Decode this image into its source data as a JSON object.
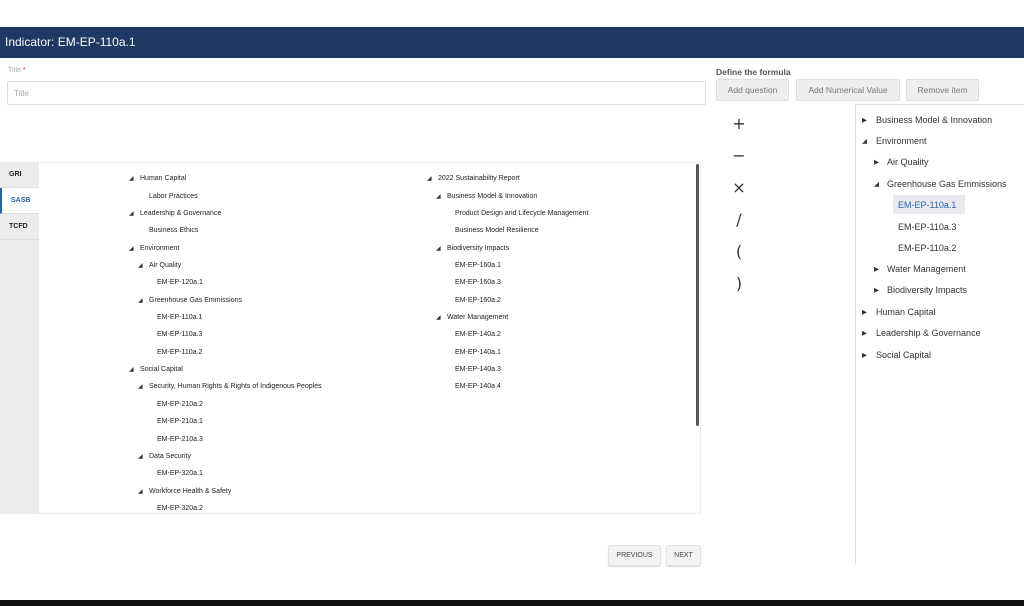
{
  "header": {
    "title": "Indicator: EM-EP-110a.1"
  },
  "title_field": {
    "label": "Title",
    "required_mark": "*",
    "placeholder": "Title",
    "value": ""
  },
  "formula": {
    "title": "Define the formula",
    "buttons": {
      "add_question": "Add question",
      "add_numerical": "Add Numerical Value",
      "remove_item": "Remove item"
    },
    "operators": [
      "+",
      "−",
      "×",
      "/",
      "(",
      ")"
    ]
  },
  "tabs": [
    "GRI",
    "SASB",
    "TCFD"
  ],
  "active_tab": "SASB",
  "left_tree": [
    "Human Capital",
    "Labor Practices",
    "Leadership & Governance",
    "Business Ethics",
    "Environment",
    "Air Quality",
    "EM-EP-120a.1",
    "Greenhouse Gas Emmissions",
    "EM-EP-110a.1",
    "EM-EP-110a.3",
    "EM-EP-110a.2",
    "Social Capital",
    "Security, Human Rights & Rights of Indigenous Peoples",
    "EM-EP-210a.2",
    "EM-EP-210a.1",
    "EM-EP-210a.3",
    "Data Security",
    "EM-EP-320a.1",
    "Workforce Health & Safety",
    "EM-EP-320a.2"
  ],
  "middle_tree": [
    "2022 Sustainability Report",
    "Business Model & Innovation",
    "Product Design and Lifecycle Management",
    "Business Model Resilience",
    "Biodiversity Impacts",
    "EM-EP-160a.1",
    "EM-EP-160a.3",
    "EM-EP-160a.2",
    "Water Management",
    "EM-EP-140a.2",
    "EM-EP-140a.1",
    "EM-EP-140a.3",
    "EM-EP-140a.4"
  ],
  "right_tree": [
    "Business Model & Innovation",
    "Environment",
    "Air Quality",
    "Greenhouse Gas Emmissions",
    "EM-EP-110a.1",
    "EM-EP-110a.3",
    "EM-EP-110a.2",
    "Water Management",
    "Biodiversity Impacts",
    "Human Capital",
    "Leadership & Governance",
    "Social Capital"
  ],
  "right_selected": "EM-EP-110a.1",
  "pager": {
    "previous": "PREVIOUS",
    "next": "NEXT"
  },
  "colors": {
    "header_bg": "#1f3864",
    "accent": "#2563b0",
    "selected_bg": "#e8eaf0"
  }
}
